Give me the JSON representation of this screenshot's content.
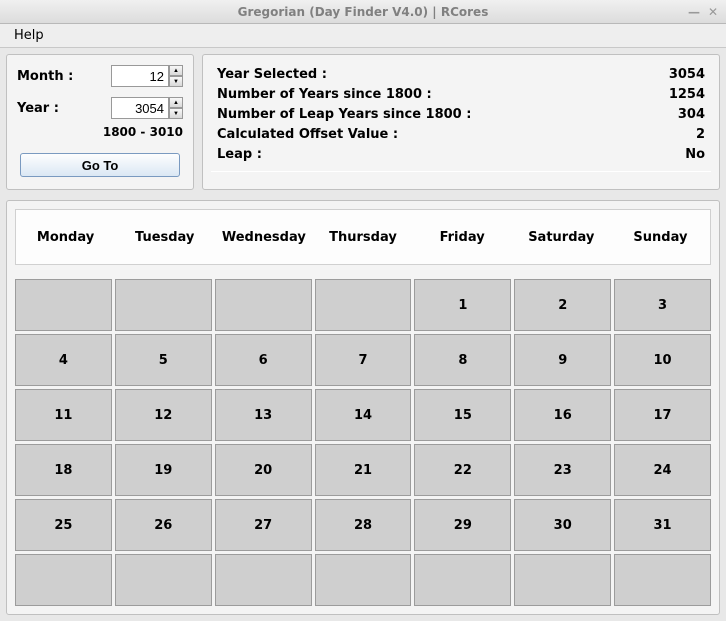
{
  "window": {
    "title": "Gregorian (Day Finder V4.0) | RCores",
    "minimize": "—",
    "close": "✕"
  },
  "menu": {
    "help": "Help"
  },
  "inputs": {
    "month_label": "Month :",
    "month_value": "12",
    "year_label": "Year :",
    "year_value": "3054",
    "range_hint": "1800 - 3010",
    "goto_label": "Go To"
  },
  "info": {
    "year_selected_label": "Year Selected :",
    "year_selected_value": "3054",
    "years_since_label": "Number of Years since 1800 :",
    "years_since_value": "1254",
    "leap_years_label": "Number of Leap Years since 1800 :",
    "leap_years_value": "304",
    "offset_label": "Calculated Offset Value :",
    "offset_value": "2",
    "leap_label": "Leap :",
    "leap_value": "No"
  },
  "calendar": {
    "headers": [
      "Monday",
      "Tuesday",
      "Wednesday",
      "Thursday",
      "Friday",
      "Saturday",
      "Sunday"
    ],
    "cells": [
      "",
      "",
      "",
      "",
      "1",
      "2",
      "3",
      "4",
      "5",
      "6",
      "7",
      "8",
      "9",
      "10",
      "11",
      "12",
      "13",
      "14",
      "15",
      "16",
      "17",
      "18",
      "19",
      "20",
      "21",
      "22",
      "23",
      "24",
      "25",
      "26",
      "27",
      "28",
      "29",
      "30",
      "31",
      "",
      "",
      "",
      "",
      "",
      "",
      ""
    ]
  }
}
